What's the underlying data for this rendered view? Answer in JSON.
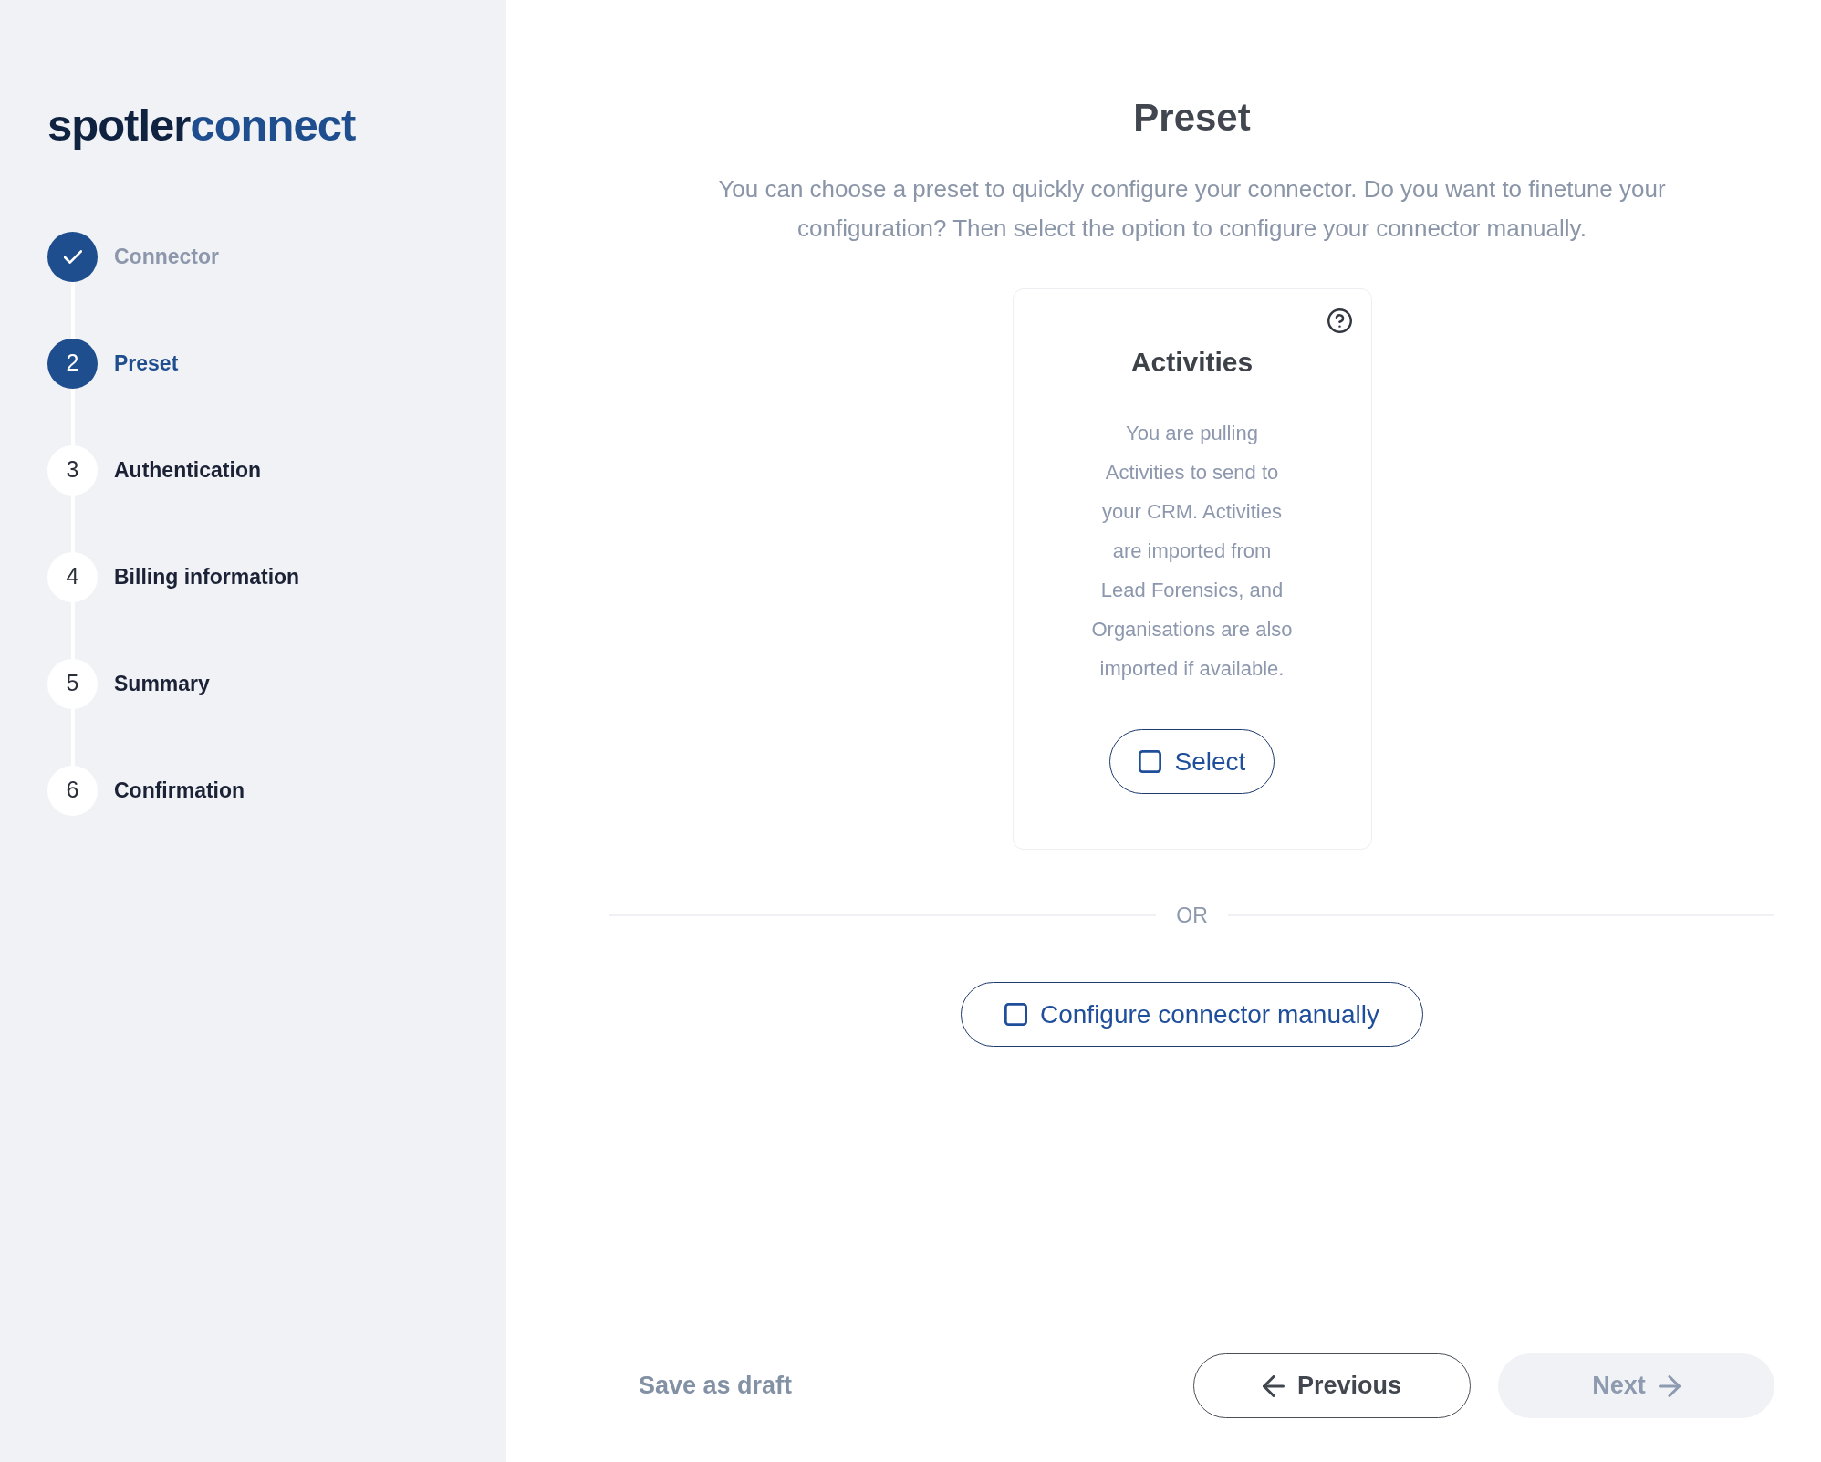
{
  "sidebar": {
    "logo": {
      "dark_part": "spotler",
      "blue_part": "connect"
    },
    "steps": [
      {
        "label": "Connector",
        "completed": true,
        "selected": false
      },
      {
        "number": "2",
        "label": "Preset",
        "completed": false,
        "selected": true
      },
      {
        "number": "3",
        "label": "Authentication",
        "completed": false,
        "selected": false
      },
      {
        "number": "4",
        "label": "Billing information",
        "completed": false,
        "selected": false
      },
      {
        "number": "5",
        "label": "Summary",
        "completed": false,
        "selected": false
      },
      {
        "number": "6",
        "label": "Confirmation",
        "completed": false,
        "selected": false
      }
    ]
  },
  "main": {
    "title": "Preset",
    "description": "You can choose a preset to quickly configure your connector. Do you want to finetune your\nconfiguration? Then select the option to configure your connector manually.",
    "presets": [
      {
        "title": "Activities",
        "description": "You are pulling\nActivities to send to\nyour CRM. Activities\nare imported from\nLead Forensics, and\nOrganisations are also\nimported if available.",
        "select_button": {
          "label": "Select",
          "checked": false
        }
      }
    ],
    "divider_text": "OR",
    "manual_button": {
      "label": "Configure connector manually",
      "checked": false
    }
  },
  "footer": {
    "save_draft_button": "Save as draft",
    "previous_button": {
      "label": "Previous"
    },
    "next_button": {
      "label": "Next",
      "disabled": true
    }
  }
}
